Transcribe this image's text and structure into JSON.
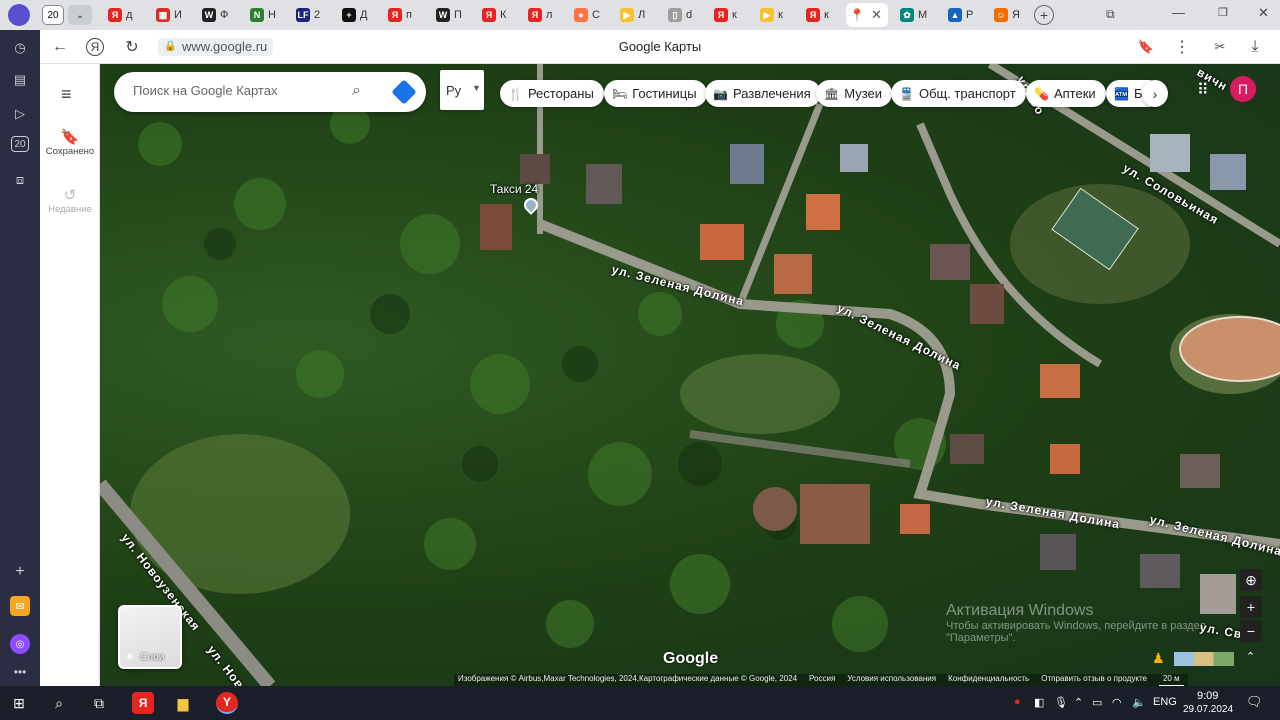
{
  "browser": {
    "tab_count_badge": "20",
    "tabs": [
      {
        "icon": "yandex-icon",
        "color": "#e52620",
        "label": "Я",
        "text": "д"
      },
      {
        "icon": "calendar-icon",
        "color": "#d93025",
        "label": "▦",
        "text": "И"
      },
      {
        "icon": "wikipedia-icon",
        "color": "#222222",
        "label": "W",
        "text": "Ф"
      },
      {
        "icon": "green-site-icon",
        "color": "#2e7d32",
        "label": "N",
        "text": "Н"
      },
      {
        "icon": "lf-icon",
        "color": "#1a237e",
        "label": "LF",
        "text": "2"
      },
      {
        "icon": "plus-site-icon",
        "color": "#111111",
        "label": "+",
        "text": "Д"
      },
      {
        "icon": "yandex-icon",
        "color": "#e52620",
        "label": "Я",
        "text": "п"
      },
      {
        "icon": "wikipedia-icon",
        "color": "#222222",
        "label": "W",
        "text": "П"
      },
      {
        "icon": "yandex-icon",
        "color": "#e52620",
        "label": "Я",
        "text": "К"
      },
      {
        "icon": "yandex-icon",
        "color": "#e52620",
        "label": "Я",
        "text": "л"
      },
      {
        "icon": "fox-icon",
        "color": "#ff7043",
        "label": "●",
        "text": "С"
      },
      {
        "icon": "play-icon",
        "color": "#fbc02d",
        "label": "▶",
        "text": "Л"
      },
      {
        "icon": "document-icon",
        "color": "#9e9e9e",
        "label": "▯",
        "text": "d"
      },
      {
        "icon": "yandex-icon",
        "color": "#e52620",
        "label": "Я",
        "text": "к"
      },
      {
        "icon": "play-icon",
        "color": "#fbc02d",
        "label": "▶",
        "text": "к"
      },
      {
        "icon": "yandex-icon",
        "color": "#e52620",
        "label": "Я",
        "text": "к"
      }
    ],
    "active_tab": {
      "icon": "google-maps-icon",
      "color": "#34a853",
      "close": "✕"
    },
    "after_tabs": [
      {
        "icon": "colorful-app-icon",
        "color": "#00897b",
        "label": "✿",
        "text": "М"
      },
      {
        "icon": "blue-chart-icon",
        "color": "#1565c0",
        "label": "▲",
        "text": "Р"
      },
      {
        "icon": "orange-site-icon",
        "color": "#ef6c00",
        "label": "☺",
        "text": "Я"
      }
    ],
    "url": "www.google.ru",
    "page_title": "Google Карты"
  },
  "maps": {
    "search_placeholder": "Поиск на Google Картах",
    "lang_button": "Ру",
    "rail": {
      "saved": "Сохранено",
      "recent": "Недавние"
    },
    "chips": [
      {
        "icon": "🍴",
        "label": "Рестораны"
      },
      {
        "icon": "🛏",
        "label": "Гостиницы"
      },
      {
        "icon": "📷",
        "label": "Развлечения"
      },
      {
        "icon": "🏛",
        "label": "Музеи"
      },
      {
        "icon": "🚆",
        "label": "Общ. транспорт"
      },
      {
        "icon": "💊",
        "label": "Аптеки"
      },
      {
        "icon": "🏧",
        "label": "Ба"
      }
    ],
    "profile_initial": "П",
    "poi_label": "Такси 24",
    "roads": {
      "r1": "ул. Зеленая Долина",
      "r2": "ул. Зеленая Долина",
      "r3": "ул. Зеленая Долина",
      "r4": "ул. Зеленая Долина",
      "r5": "ул. Соловьиная",
      "r6": "ул. Новоузенская",
      "r7": "ул. Ново",
      "r8": "ул. Свет",
      "r9": "ул. Со",
      "r10": "вичн"
    },
    "layers_label": "Слои",
    "google_logo": "Google",
    "attribution": "Изображения © Airbus,Maxar Technologies, 2024,Картографические данные © Google, 2024",
    "footer_links": [
      "Россия",
      "Условия использования",
      "Конфиденциальность",
      "Отправить отзыв о продукте"
    ],
    "scale": "20 м",
    "watermark_title": "Активация Windows",
    "watermark_sub": "Чтобы активировать Windows, перейдите в раздел",
    "watermark_sub2": "\"Параметры\"."
  },
  "taskbar": {
    "lang": "ENG",
    "time": "9:09",
    "date": "29.07.2024"
  }
}
